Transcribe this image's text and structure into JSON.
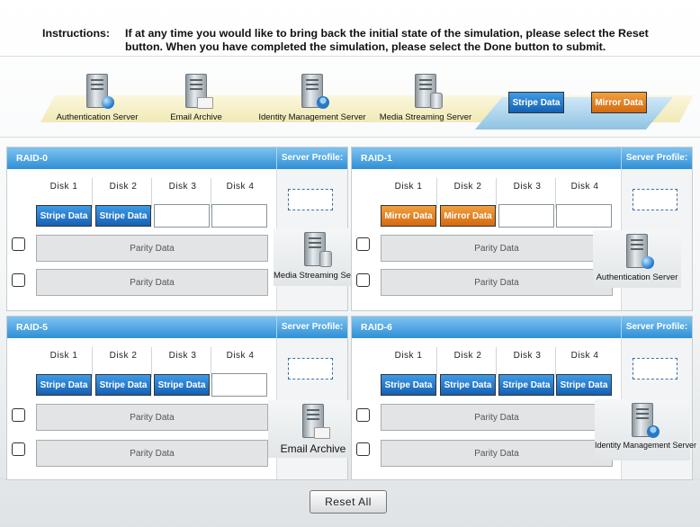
{
  "instructions": {
    "label": "Instructions:",
    "text": "If at any time you would like to bring back the initial state of the simulation, please select the Reset button. When you have completed the simulation, please select the Done button to submit."
  },
  "servers": [
    {
      "label": "Authentication Server",
      "icon": "server-globe-icon"
    },
    {
      "label": "Email Archive",
      "icon": "server-mail-icon"
    },
    {
      "label": "Identity Management Server",
      "icon": "server-user-icon"
    },
    {
      "label": "Media Streaming Server",
      "icon": "server-database-icon"
    }
  ],
  "palette": {
    "stripe": "Stripe Data",
    "mirror": "Mirror Data"
  },
  "colors": {
    "stripe": "#1f6fc2",
    "mirror": "#e07b1c",
    "header": "#3a98dc"
  },
  "raid0": {
    "title": "RAID-0",
    "profile_label": "Server Profile:",
    "disks": [
      "Disk 1",
      "Disk 2",
      "Disk 3",
      "Disk 4"
    ],
    "slots": [
      "Stripe Data",
      "Stripe Data",
      "",
      ""
    ],
    "parity": [
      "Parity Data",
      "Parity Data"
    ],
    "assigned": "Media Streaming Server"
  },
  "raid1": {
    "title": "RAID-1",
    "profile_label": "Server Profile:",
    "disks": [
      "Disk 1",
      "Disk 2",
      "Disk 3",
      "Disk 4"
    ],
    "slots": [
      "Mirror Data",
      "Mirror Data",
      "",
      ""
    ],
    "parity": [
      "Parity Data",
      "Parity Data"
    ],
    "assigned": "Authentication Server"
  },
  "raid5": {
    "title": "RAID-5",
    "profile_label": "Server Profile:",
    "disks": [
      "Disk 1",
      "Disk 2",
      "Disk 3",
      "Disk 4"
    ],
    "slots": [
      "Stripe Data",
      "Stripe Data",
      "Stripe Data",
      ""
    ],
    "parity": [
      "Parity Data",
      "Parity Data"
    ],
    "assigned": "Email Archive"
  },
  "raid6": {
    "title": "RAID-6",
    "profile_label": "Server Profile:",
    "disks": [
      "Disk 1",
      "Disk 2",
      "Disk 3",
      "Disk 4"
    ],
    "slots": [
      "Stripe Data",
      "Stripe Data",
      "Stripe Data",
      "Stripe Data"
    ],
    "parity": [
      "Parity Data",
      "Parity Data"
    ],
    "assigned": "Identity Management Server"
  },
  "reset_label": "Reset All"
}
